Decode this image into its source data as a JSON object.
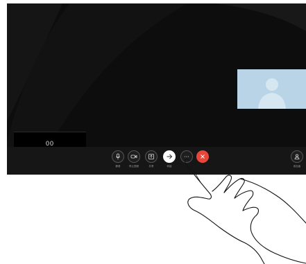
{
  "meeting": {
    "participant_name": "00"
  },
  "controls": {
    "mute_label": "静音",
    "stop_video_label": "停止视频",
    "share_label": "共享",
    "transfer_label": "转接",
    "more_label": "",
    "end_label": "",
    "participants_label": "参加者"
  },
  "colors": {
    "end_call": "#e8463a",
    "self_view_bg": "#b8d4e6",
    "screen_bg": "#0d0d0d"
  },
  "icons": {
    "mute": "microphone-icon",
    "stop_video": "camera-icon",
    "share": "share-screen-icon",
    "transfer": "arrow-right-icon",
    "more": "more-icon",
    "end": "close-icon",
    "participants": "person-icon"
  }
}
